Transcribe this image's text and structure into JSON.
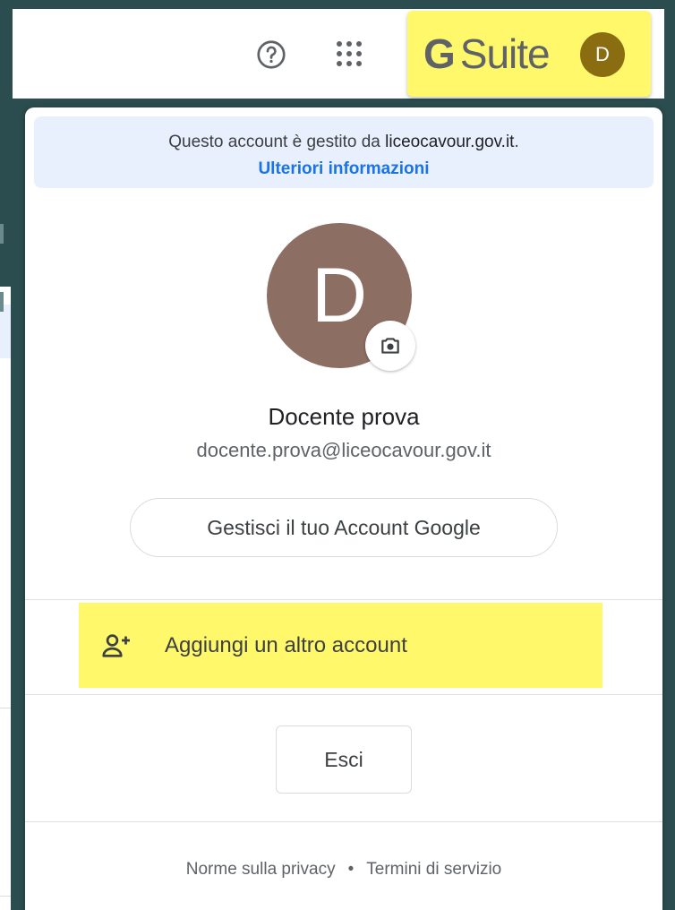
{
  "topbar": {
    "help_icon": "help-circle-icon",
    "apps_icon": "apps-grid-icon",
    "gsuite": {
      "g": "G",
      "suite": "Suite"
    },
    "avatar_initial": "D"
  },
  "popup": {
    "managed_prefix": "Questo account è gestito da",
    "managed_domain": "liceocavour.gov.it",
    "managed_suffix": ".",
    "more_info": "Ulteriori informazioni",
    "avatar_initial": "D",
    "camera_icon": "camera-icon",
    "name": "Docente prova",
    "email": "docente.prova@liceocavour.gov.it",
    "manage_account": "Gestisci il tuo Account Google",
    "add_account": "Aggiungi un altro account",
    "add_account_icon": "person-add-icon",
    "sign_out": "Esci",
    "footer": {
      "privacy": "Norme sulla privacy",
      "separator": "•",
      "terms": "Termini di servizio"
    }
  },
  "colors": {
    "highlight": "#fff86b",
    "link": "#1a73e8",
    "avatar_bg": "#8d6e63",
    "small_avatar_bg": "#8a6d10"
  }
}
